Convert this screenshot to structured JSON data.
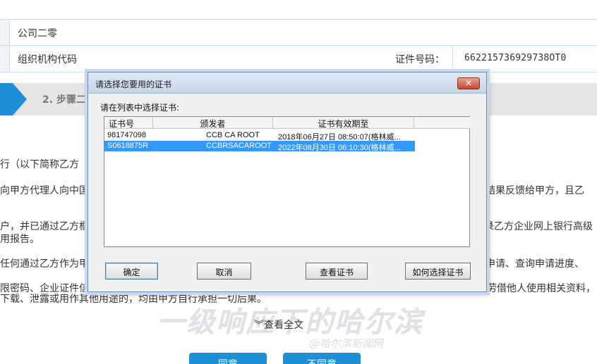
{
  "page": {
    "company_row": "公司二零",
    "org_code_label": "组织机构代码",
    "cert_no_label": "证件号码：",
    "cert_no_value": "662215736929738OT0",
    "step_label": "2. 步骤二",
    "paragraphs": [
      "行（以下简称乙方",
      "向甲方代理人向中国",
      "询结果反馈给甲方，且乙",
      "户，并已通过乙方框",
      "录乙方企业网上银行高级",
      "用报告。",
      "任何通过乙方作为甲",
      "询申请、查询申请进度、",
      "限密码、企业证件信",
      "劳借他人使用相关资料，",
      "下载、泄露或用作其他用途的，均由甲方自行承担一切后果。"
    ],
    "view_all": "查看全文",
    "view_all_icon": "double-chevron-down-icon",
    "watermark": "一级响应下的哈尔滨",
    "watermark_sub": "@哈尔滨新闻网",
    "agree_button": "同意",
    "disagree_button": "不同意",
    "accent_color": "#1e8fd6"
  },
  "dialog": {
    "title": "请选择您要用的证书",
    "close_label": "✕",
    "instruction": "请在列表中选择证书:",
    "columns": [
      "证书号",
      "颁发者",
      "证书有效期至",
      ""
    ],
    "rows": [
      {
        "cert_no": "981747098",
        "issuer": "CCB CA ROOT",
        "expiry": "2018年06月27日 08:50:07(格林威...",
        "selected": false
      },
      {
        "cert_no": "S0618875R",
        "issuer": "CCBRSACAROOT",
        "expiry": "2022年08月30日 06:10:30(格林威...",
        "selected": true
      }
    ],
    "buttons": {
      "ok": "确定",
      "cancel": "取消",
      "view_cert": "查看证书",
      "how_to_choose": "如何选择证书"
    },
    "selection_color": "#3399ff"
  }
}
